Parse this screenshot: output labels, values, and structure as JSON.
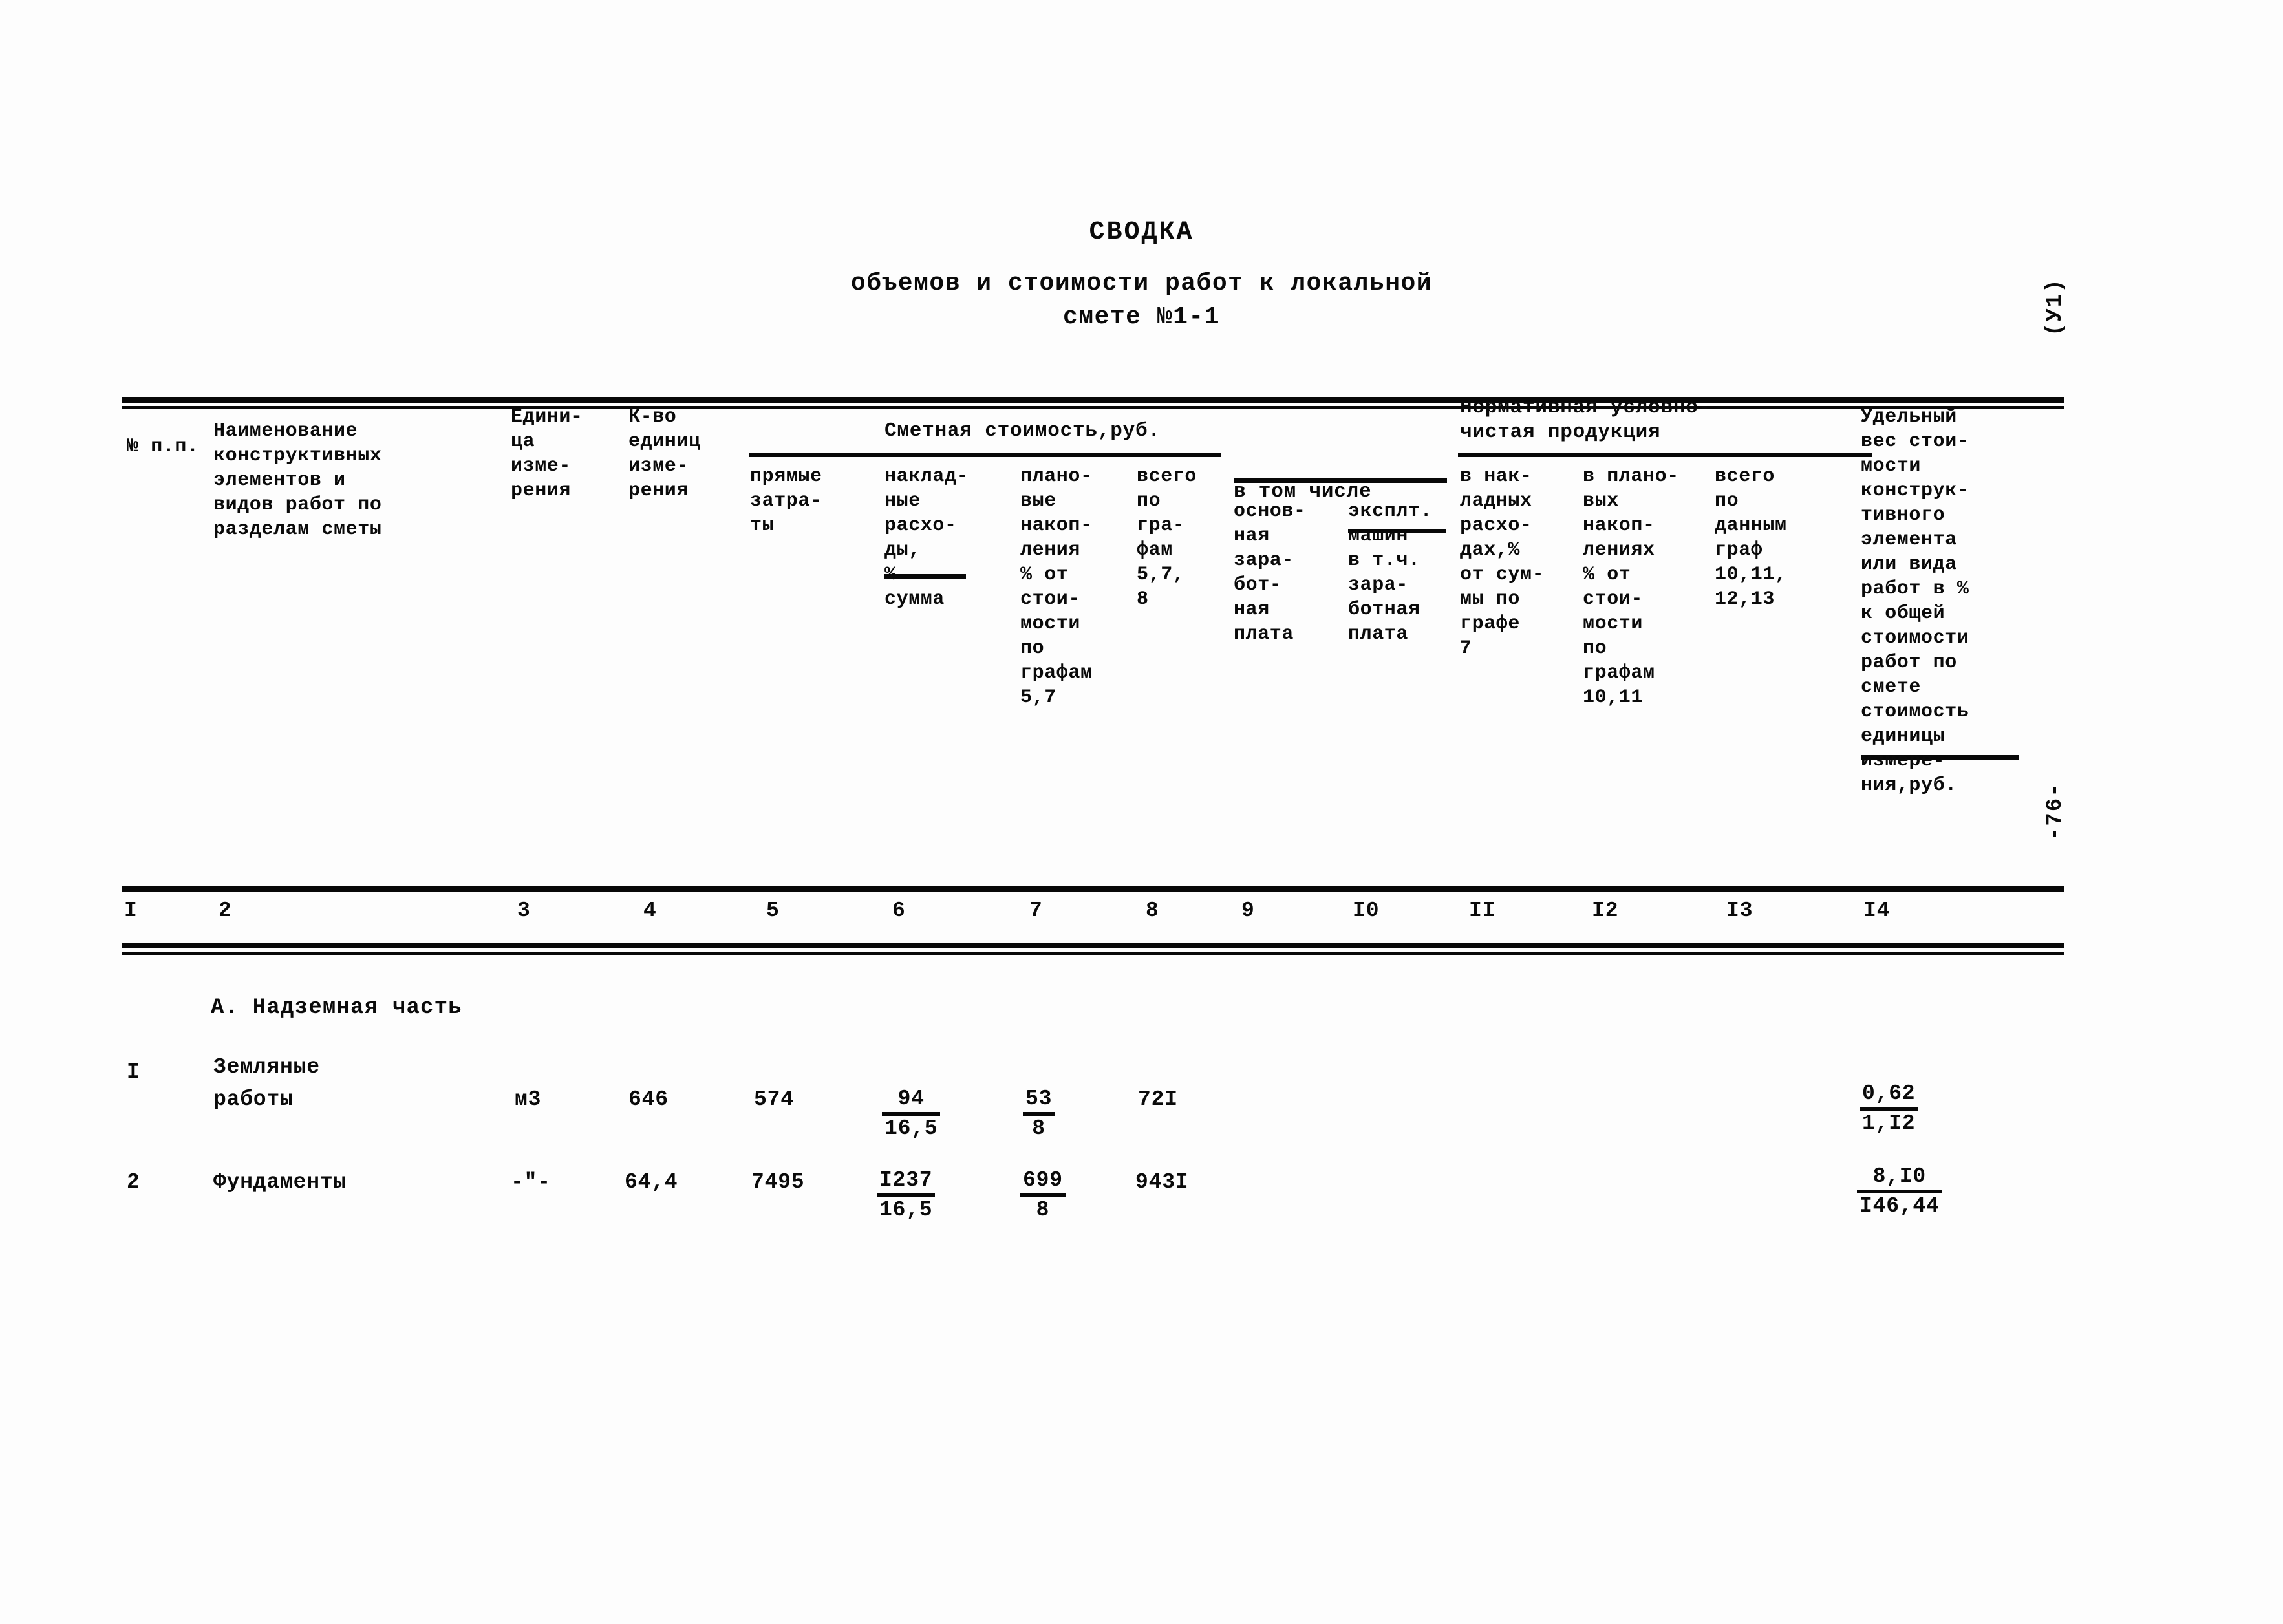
{
  "document": {
    "title_main": "СВОДКА",
    "title_line1": "объемов и стоимости работ к локальной",
    "title_line2": "смете №1-1",
    "section_mark": "(У1)",
    "page_number": "-76-"
  },
  "table": {
    "group_captions": {
      "estimate_cost": "Сметная стоимость,руб.",
      "including": "в том числе",
      "normative_output": "Нормативная условно-\nчистая продукция"
    },
    "headers": {
      "col1": "№ п.п.",
      "col2": "Наименование\nконструктивных\nэлементов и\nвидов работ по\nразделам сметы",
      "col3": "Едини-\nца\nизме-\nрения",
      "col4": "К-во\nединиц\nизме-\nрения",
      "col5": "прямые\nзатра-\nты",
      "col6": "наклад-\nные\nрасхо-\nды,\n%\nсумма",
      "col7": "плано-\nвые\nнакоп-\nления\n% от\nстои-\nмости\nпо\nграфам\n5,7",
      "col8": "всего\nпо\nгра-\nфам\n5,7,\n8",
      "col9": "основ-\nная\nзара-\nбот-\nная\nплата",
      "col10": "эксплт.\nмашин\nв т.ч.\nзара-\nботная\nплата",
      "col11": "в нак-\nладных\nрасхо-\nдах,%\nот сум-\nмы по\nграфе\n7",
      "col12": "в плано-\nвых\nнакоп-\nлениях\n% от\nстои-\nмости\nпо\nграфам\n10,11",
      "col13": "всего\nпо\nданным\nграф\n10,11,\n12,13",
      "col14": "Удельный\nвес стои-\nмости\nконструк-\nтивного\nэлемента\nили вида\nработ в %\nк общей\nстоимости\nработ по\nсмете\nстоимость\nединицы\nизмере-\nния,руб."
    },
    "column_numbers": [
      "I",
      "2",
      "3",
      "4",
      "5",
      "6",
      "7",
      "8",
      "9",
      "I0",
      "II",
      "I2",
      "I3",
      "I4"
    ],
    "section_heading": "А. Надземная часть",
    "rows": [
      {
        "num": "I",
        "name_line1": "Земляные",
        "name_line2": "работы",
        "unit": "м3",
        "qty": "646",
        "direct": "574",
        "overhead_num": "94",
        "overhead_den": "16,5",
        "savings_num": "53",
        "savings_den": "8",
        "total": "72I",
        "base_wage": "",
        "machines": "",
        "nuo_overhead": "",
        "nuo_savings": "",
        "nuo_total": "",
        "share_num": "0,62",
        "share_den": "1,I2"
      },
      {
        "num": "2",
        "name_line1": "Фундаменты",
        "name_line2": "",
        "unit": "-\"-",
        "qty": "64,4",
        "direct": "7495",
        "overhead_num": "I237",
        "overhead_den": "16,5",
        "savings_num": "699",
        "savings_den": "8",
        "total": "943I",
        "base_wage": "",
        "machines": "",
        "nuo_overhead": "",
        "nuo_savings": "",
        "nuo_total": "",
        "share_num": "8,I0",
        "share_den": "I46,44"
      }
    ]
  }
}
